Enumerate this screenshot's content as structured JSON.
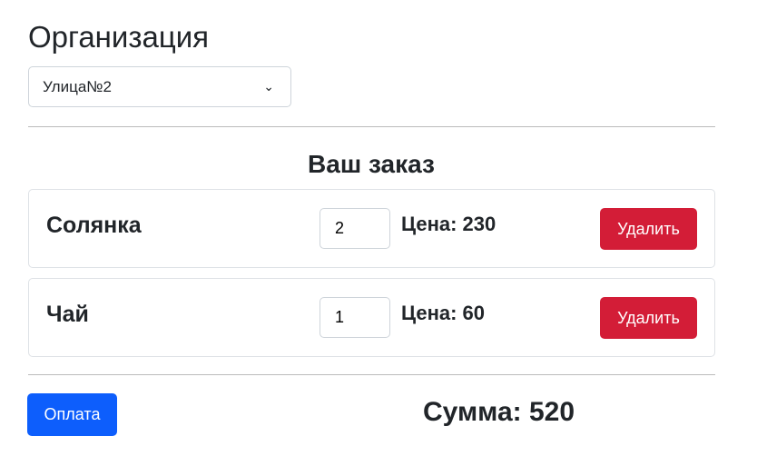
{
  "header": {
    "title": "Организация"
  },
  "organization_select": {
    "value": "Улица№2",
    "icon": "chevron-down-icon"
  },
  "order": {
    "title": "Ваш заказ",
    "items": [
      {
        "name": "Солянка",
        "quantity": "2",
        "price": "Цена: 230",
        "delete_label": "Удалить"
      },
      {
        "name": "Чай",
        "quantity": "1",
        "price": "Цена: 60",
        "delete_label": "Удалить"
      }
    ]
  },
  "footer": {
    "pay_label": "Оплата",
    "total": "Сумма: 520"
  },
  "colors": {
    "danger": "#d31d37",
    "primary": "#0d5efc"
  }
}
